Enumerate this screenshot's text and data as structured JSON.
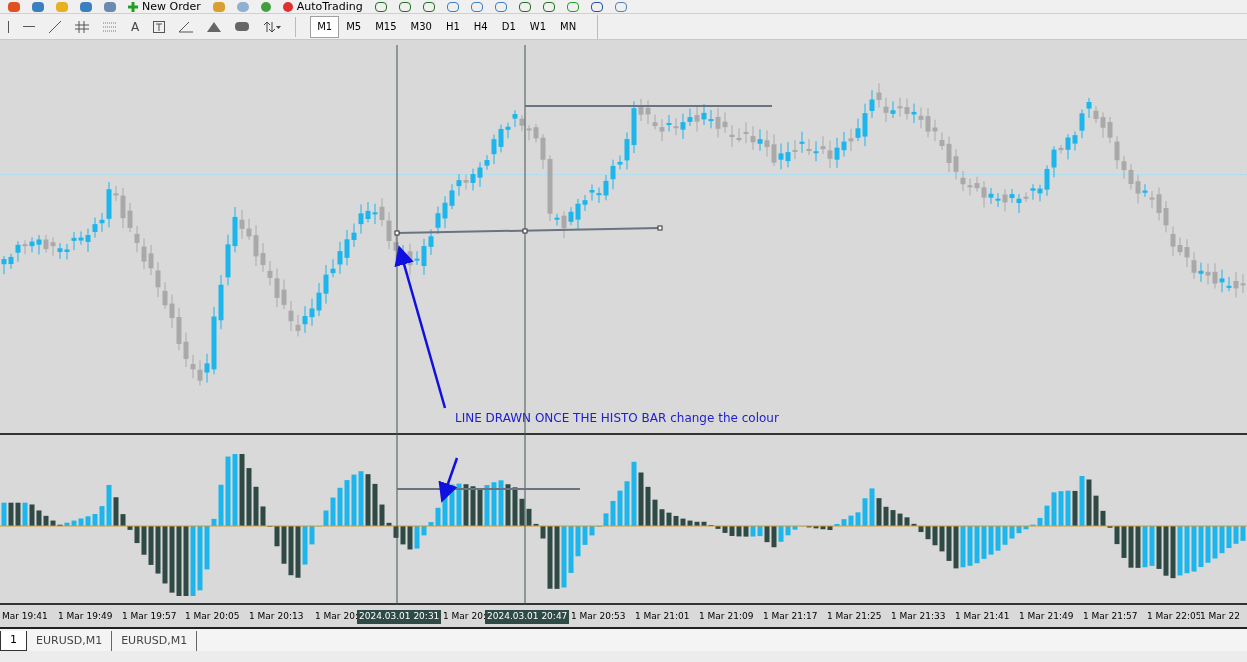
{
  "toolbar": {
    "buttons": [
      {
        "label": "New Order"
      },
      {
        "label": "AutoTrading"
      }
    ]
  },
  "drawing_toolbar": {
    "text_tool": "A"
  },
  "timeframes": [
    {
      "label": "M1",
      "selected": true
    },
    {
      "label": "M5",
      "selected": false
    },
    {
      "label": "M15",
      "selected": false
    },
    {
      "label": "M30",
      "selected": false
    },
    {
      "label": "H1",
      "selected": false
    },
    {
      "label": "H4",
      "selected": false
    },
    {
      "label": "D1",
      "selected": false
    },
    {
      "label": "W1",
      "selected": false
    },
    {
      "label": "MN",
      "selected": false
    }
  ],
  "chart": {
    "annotation": "LINE DRAWN ONCE THE HISTO BAR change the colour"
  },
  "time_axis": [
    {
      "text": "Mar 19:41",
      "kind": "tick"
    },
    {
      "text": "1 Mar 19:49",
      "kind": "tick"
    },
    {
      "text": "1 Mar 19:57",
      "kind": "tick"
    },
    {
      "text": "1 Mar 20:05",
      "kind": "tick"
    },
    {
      "text": "1 Mar 20:13",
      "kind": "tick"
    },
    {
      "text": "1 Mar 20:",
      "kind": "tick"
    },
    {
      "text": "2024.03.01 20:31",
      "kind": "cursor"
    },
    {
      "text": "1 Mar 20:",
      "kind": "tick"
    },
    {
      "text": "2024.03.01 20:47",
      "kind": "cursor"
    },
    {
      "text": "1 Mar 20:53",
      "kind": "tick"
    },
    {
      "text": "1 Mar 21:01",
      "kind": "tick"
    },
    {
      "text": "1 Mar 21:09",
      "kind": "tick"
    },
    {
      "text": "1 Mar 21:17",
      "kind": "tick"
    },
    {
      "text": "1 Mar 21:25",
      "kind": "tick"
    },
    {
      "text": "1 Mar 21:33",
      "kind": "tick"
    },
    {
      "text": "1 Mar 21:41",
      "kind": "tick"
    },
    {
      "text": "1 Mar 21:49",
      "kind": "tick"
    },
    {
      "text": "1 Mar 21:57",
      "kind": "tick"
    },
    {
      "text": "1 Mar 22:05",
      "kind": "tick"
    },
    {
      "text": "1 Mar 22",
      "kind": "tick"
    }
  ],
  "tabs": [
    {
      "label": "1",
      "selected": true
    },
    {
      "label": "EURUSD,M1",
      "selected": false
    },
    {
      "label": "EURUSD,M1",
      "selected": false
    }
  ]
}
